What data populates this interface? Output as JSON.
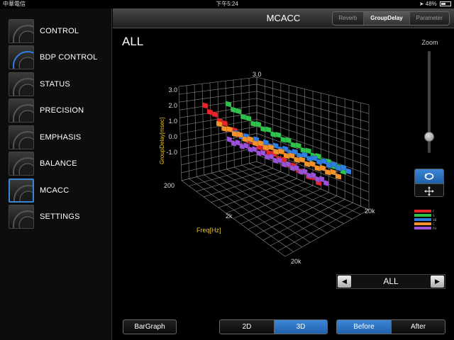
{
  "status_bar": {
    "carrier": "中華電信",
    "time": "下午5:24",
    "battery": "48%",
    "battery_level": 0.48
  },
  "sidebar": {
    "items": [
      {
        "label": "CONTROL",
        "icon": "control-dial-icon",
        "active": false
      },
      {
        "label": "BDP CONTROL",
        "icon": "bdp-dial-icon",
        "active": false
      },
      {
        "label": "STATUS",
        "icon": "status-icon",
        "active": false
      },
      {
        "label": "PRECISION",
        "icon": "precision-icon",
        "active": false
      },
      {
        "label": "EMPHASIS",
        "icon": "speaker-icon",
        "active": false
      },
      {
        "label": "BALANCE",
        "icon": "balance-icon",
        "active": false
      },
      {
        "label": "MCACC",
        "icon": "mcacc-icon",
        "active": true
      },
      {
        "label": "SETTINGS",
        "icon": "gear-icon",
        "active": false
      }
    ]
  },
  "header": {
    "title": "MCACC",
    "tabs": [
      {
        "label": "Reverb",
        "selected": false
      },
      {
        "label": "GroupDelay",
        "selected": true
      },
      {
        "label": "Parameter",
        "selected": false
      }
    ]
  },
  "main": {
    "channel_title": "ALL",
    "zoom_label": "Zoom",
    "zoom_level": 0.2,
    "channel_selector": {
      "value": "ALL",
      "prev_icon": "triangle-left-icon",
      "next_icon": "triangle-right-icon"
    },
    "buttons": {
      "bargraph": "BarGraph",
      "view_2d": "2D",
      "view_3d": "3D",
      "before": "Before",
      "after": "After"
    },
    "view_mode": "3D",
    "compare_mode": "Before"
  },
  "legend": [
    {
      "label": "F",
      "color": "#e8262a"
    },
    {
      "label": "S",
      "color": "#2ec24a"
    },
    {
      "label": "SB",
      "color": "#2f7fe0"
    },
    {
      "label": "C",
      "color": "#f3922a"
    },
    {
      "label": "FH",
      "color": "#9a52d8"
    }
  ],
  "chart_data": {
    "type": "3d-surface",
    "ylabel": "GroupDelay[msec]",
    "xlabel": "Freq[Hz]",
    "y_ticks": [
      "3.0",
      "2.0",
      "1.0",
      "0.0",
      "-1.0"
    ],
    "back_y_top": "3.0",
    "freq_ticks_left": [
      "200",
      "2k",
      "20k"
    ],
    "freq_ticks_right": [
      "20k"
    ],
    "series": [
      {
        "name": "F",
        "color": "#e8262a"
      },
      {
        "name": "S",
        "color": "#2ec24a"
      },
      {
        "name": "SB",
        "color": "#2f7fe0"
      },
      {
        "name": "C",
        "color": "#f3922a"
      },
      {
        "name": "FH",
        "color": "#9a52d8"
      }
    ]
  }
}
